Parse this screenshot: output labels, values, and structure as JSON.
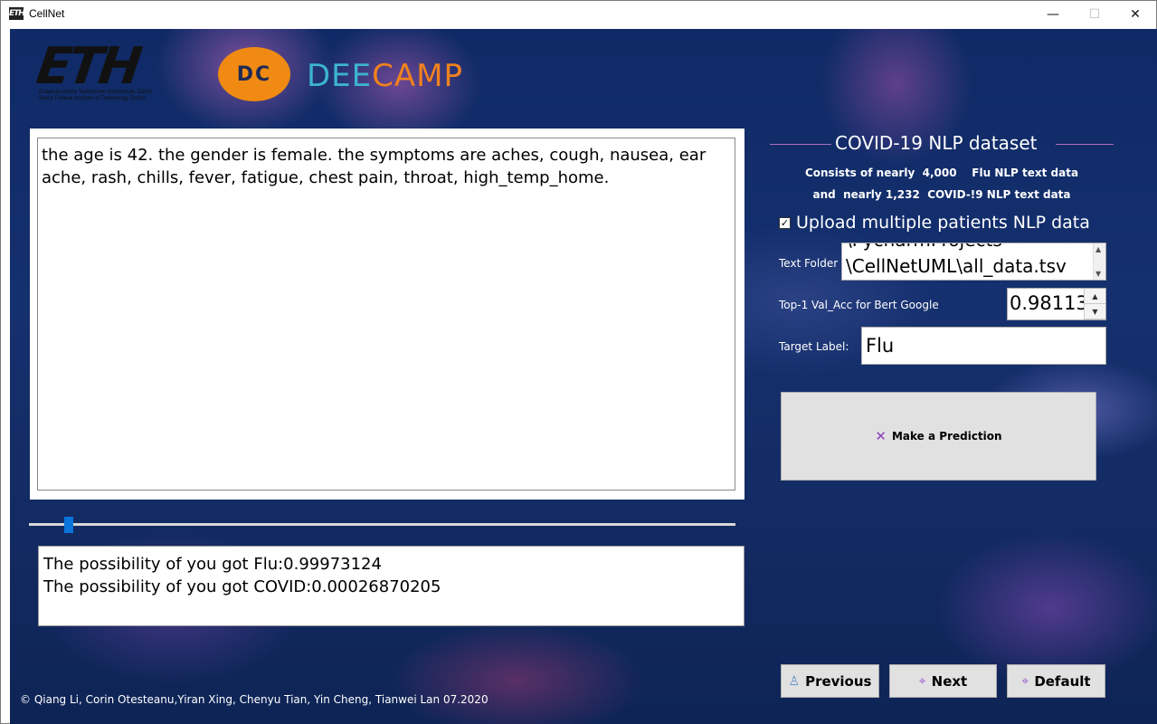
{
  "window": {
    "title": "CellNet",
    "icon_text": "ETH",
    "controls": {
      "minimize": "—",
      "maximize": "☐",
      "close": "✕"
    }
  },
  "logos": {
    "eth_mark": "ETH",
    "eth_sub_1": "Eidgenössische Technische Hochschule Zürich",
    "eth_sub_2": "Swiss Federal Institute of Technology Zurich",
    "deecamp_symbol": "DC",
    "deecamp_dee": "DEE",
    "deecamp_camp": "CAMP"
  },
  "input": {
    "text": "the age is 42. the gender is female. the symptoms are aches, cough, nausea, ear ache, rash, chills, fever, fatigue, chest pain, throat, high_temp_home."
  },
  "slider": {
    "value_fraction": 0.05
  },
  "output": {
    "line1": "The possibility of you got Flu:0.99973124",
    "line2": "The possibility of you got COVID:0.00026870205"
  },
  "footer": "© Qiang Li, Corin Otesteanu,Yiran Xing, Chenyu Tian, Yin Cheng, Tianwei Lan 07.2020",
  "dataset": {
    "title": "COVID-19 NLP dataset",
    "line1": "Consists of nearly  4,000    Flu NLP text data",
    "line2": "and  nearly 1,232  COVID-!9 NLP text data"
  },
  "upload": {
    "checked": true,
    "check_mark": "✓",
    "label": "Upload multiple patients NLP data"
  },
  "text_folder": {
    "label": "Text Folder",
    "prev_line": "\\PycharmProjects",
    "value": "\\CellNetUML\\all_data.tsv"
  },
  "accuracy": {
    "label": "Top-1 Val_Acc for Bert  Google",
    "value": "0.98113"
  },
  "target": {
    "label": "Target  Label:",
    "value": "Flu"
  },
  "buttons": {
    "predict": "Make a Prediction",
    "previous": "Previous",
    "next": "Next",
    "default": "Default"
  }
}
